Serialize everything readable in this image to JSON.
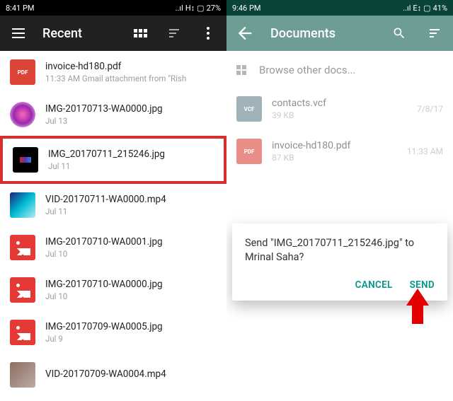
{
  "left": {
    "statusbar": {
      "time": "8:41 PM",
      "network": "..ıl",
      "extra": "H↕",
      "battery": "27%"
    },
    "appbar": {
      "title": "Recent"
    },
    "files": [
      {
        "name": "invoice-hd180.pdf",
        "meta": "11:33 AM          Gmail attachment from \"Rish",
        "thumb": "pdf"
      },
      {
        "name": "IMG-20170713-WA0000.jpg",
        "meta": "Jul 13",
        "thumb": "photo1"
      },
      {
        "name": "IMG_20170711_215246.jpg",
        "meta": "Jul 11",
        "thumb": "photo2",
        "highlighted": true
      },
      {
        "name": "VID-20170711-WA0000.mp4",
        "meta": "Jul 11",
        "thumb": "photo3"
      },
      {
        "name": "IMG-20170710-WA0001.jpg",
        "meta": "Jul 10",
        "thumb": "image"
      },
      {
        "name": "IMG-20170710-WA0000.jpg",
        "meta": "Jul 10",
        "thumb": "image"
      },
      {
        "name": "IMG-20170709-WA0005.jpg",
        "meta": "Jul 9",
        "thumb": "image"
      },
      {
        "name": "VID-20170709-WA0004.mp4",
        "meta": "",
        "thumb": "photo4"
      }
    ]
  },
  "right": {
    "statusbar": {
      "time": "9:46 PM",
      "network": "..ıl",
      "extra": "E↕",
      "battery": "41%"
    },
    "appbar": {
      "title": "Documents"
    },
    "browse_label": "Browse other docs...",
    "docs": [
      {
        "name": "contacts.vcf",
        "size": "39 KB",
        "date": "7/8/17",
        "thumb": "vcf",
        "thumbtext": "VCF"
      },
      {
        "name": "invoice-hd180.pdf",
        "size": "87 KB",
        "date": "11:33 AM",
        "thumb": "pdf",
        "thumbtext": "PDF"
      }
    ],
    "dialog": {
      "text": "Send \"IMG_20170711_215246.jpg\" to Mrinal Saha?",
      "cancel": "CANCEL",
      "send": "SEND"
    }
  }
}
